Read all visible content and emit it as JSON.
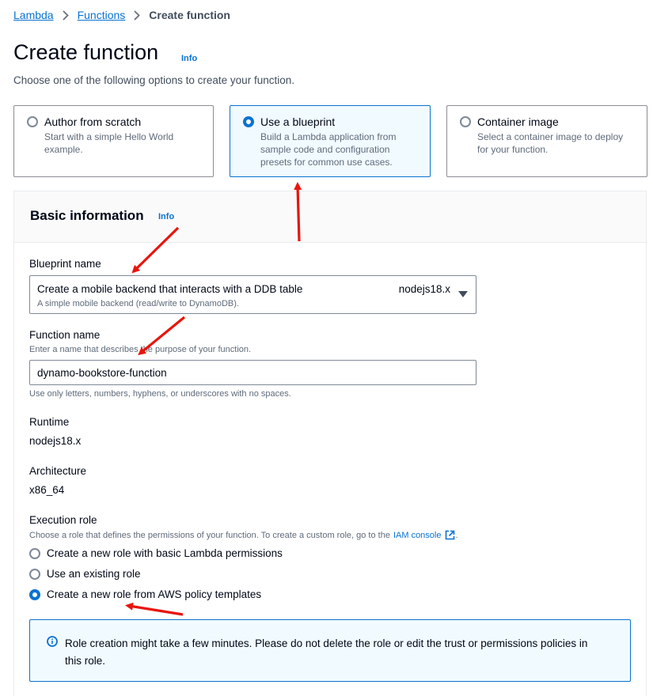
{
  "breadcrumb": {
    "items": [
      "Lambda",
      "Functions"
    ],
    "current": "Create function"
  },
  "page": {
    "title": "Create function",
    "info": "Info",
    "description": "Choose one of the following options to create your function."
  },
  "options": [
    {
      "title": "Author from scratch",
      "desc_lines": [
        "Start with a simple Hello World",
        "example."
      ],
      "selected": false
    },
    {
      "title": "Use a blueprint",
      "desc_lines": [
        "Build a Lambda application from",
        "sample code and configuration",
        "presets for common use cases."
      ],
      "selected": true
    },
    {
      "title": "Container image",
      "desc_lines": [
        "Select a container image to deploy",
        "for your function."
      ],
      "selected": false
    }
  ],
  "basic_info": {
    "title": "Basic information",
    "info": "Info",
    "blueprint": {
      "label": "Blueprint name",
      "value": "Create a mobile backend that interacts with a DDB table",
      "sub": "A simple mobile backend (read/write to DynamoDB).",
      "runtime_tag": "nodejs18.x"
    },
    "function_name": {
      "label": "Function name",
      "hint": "Enter a name that describes the purpose of your function.",
      "value": "dynamo-bookstore-function",
      "constraint": "Use only letters, numbers, hyphens, or underscores with no spaces."
    },
    "runtime": {
      "label": "Runtime",
      "value": "nodejs18.x"
    },
    "architecture": {
      "label": "Architecture",
      "value": "x86_64"
    },
    "execution_role": {
      "label": "Execution role",
      "hint": "Choose a role that defines the permissions of your function. To create a custom role, go to the",
      "hint_link": "IAM console",
      "hint_end": ".",
      "options": [
        {
          "label": "Create a new role with basic Lambda permissions",
          "selected": false
        },
        {
          "label": "Use an existing role",
          "selected": false
        },
        {
          "label": "Create a new role from AWS policy templates",
          "selected": true
        }
      ]
    },
    "alert": "Role creation might take a few minutes. Please do not delete the role or edit the trust or permissions policies in this role."
  },
  "colors": {
    "accent": "#0972d3",
    "selected_bg": "#f1faff",
    "annotation_arrow": "#e8150d"
  }
}
